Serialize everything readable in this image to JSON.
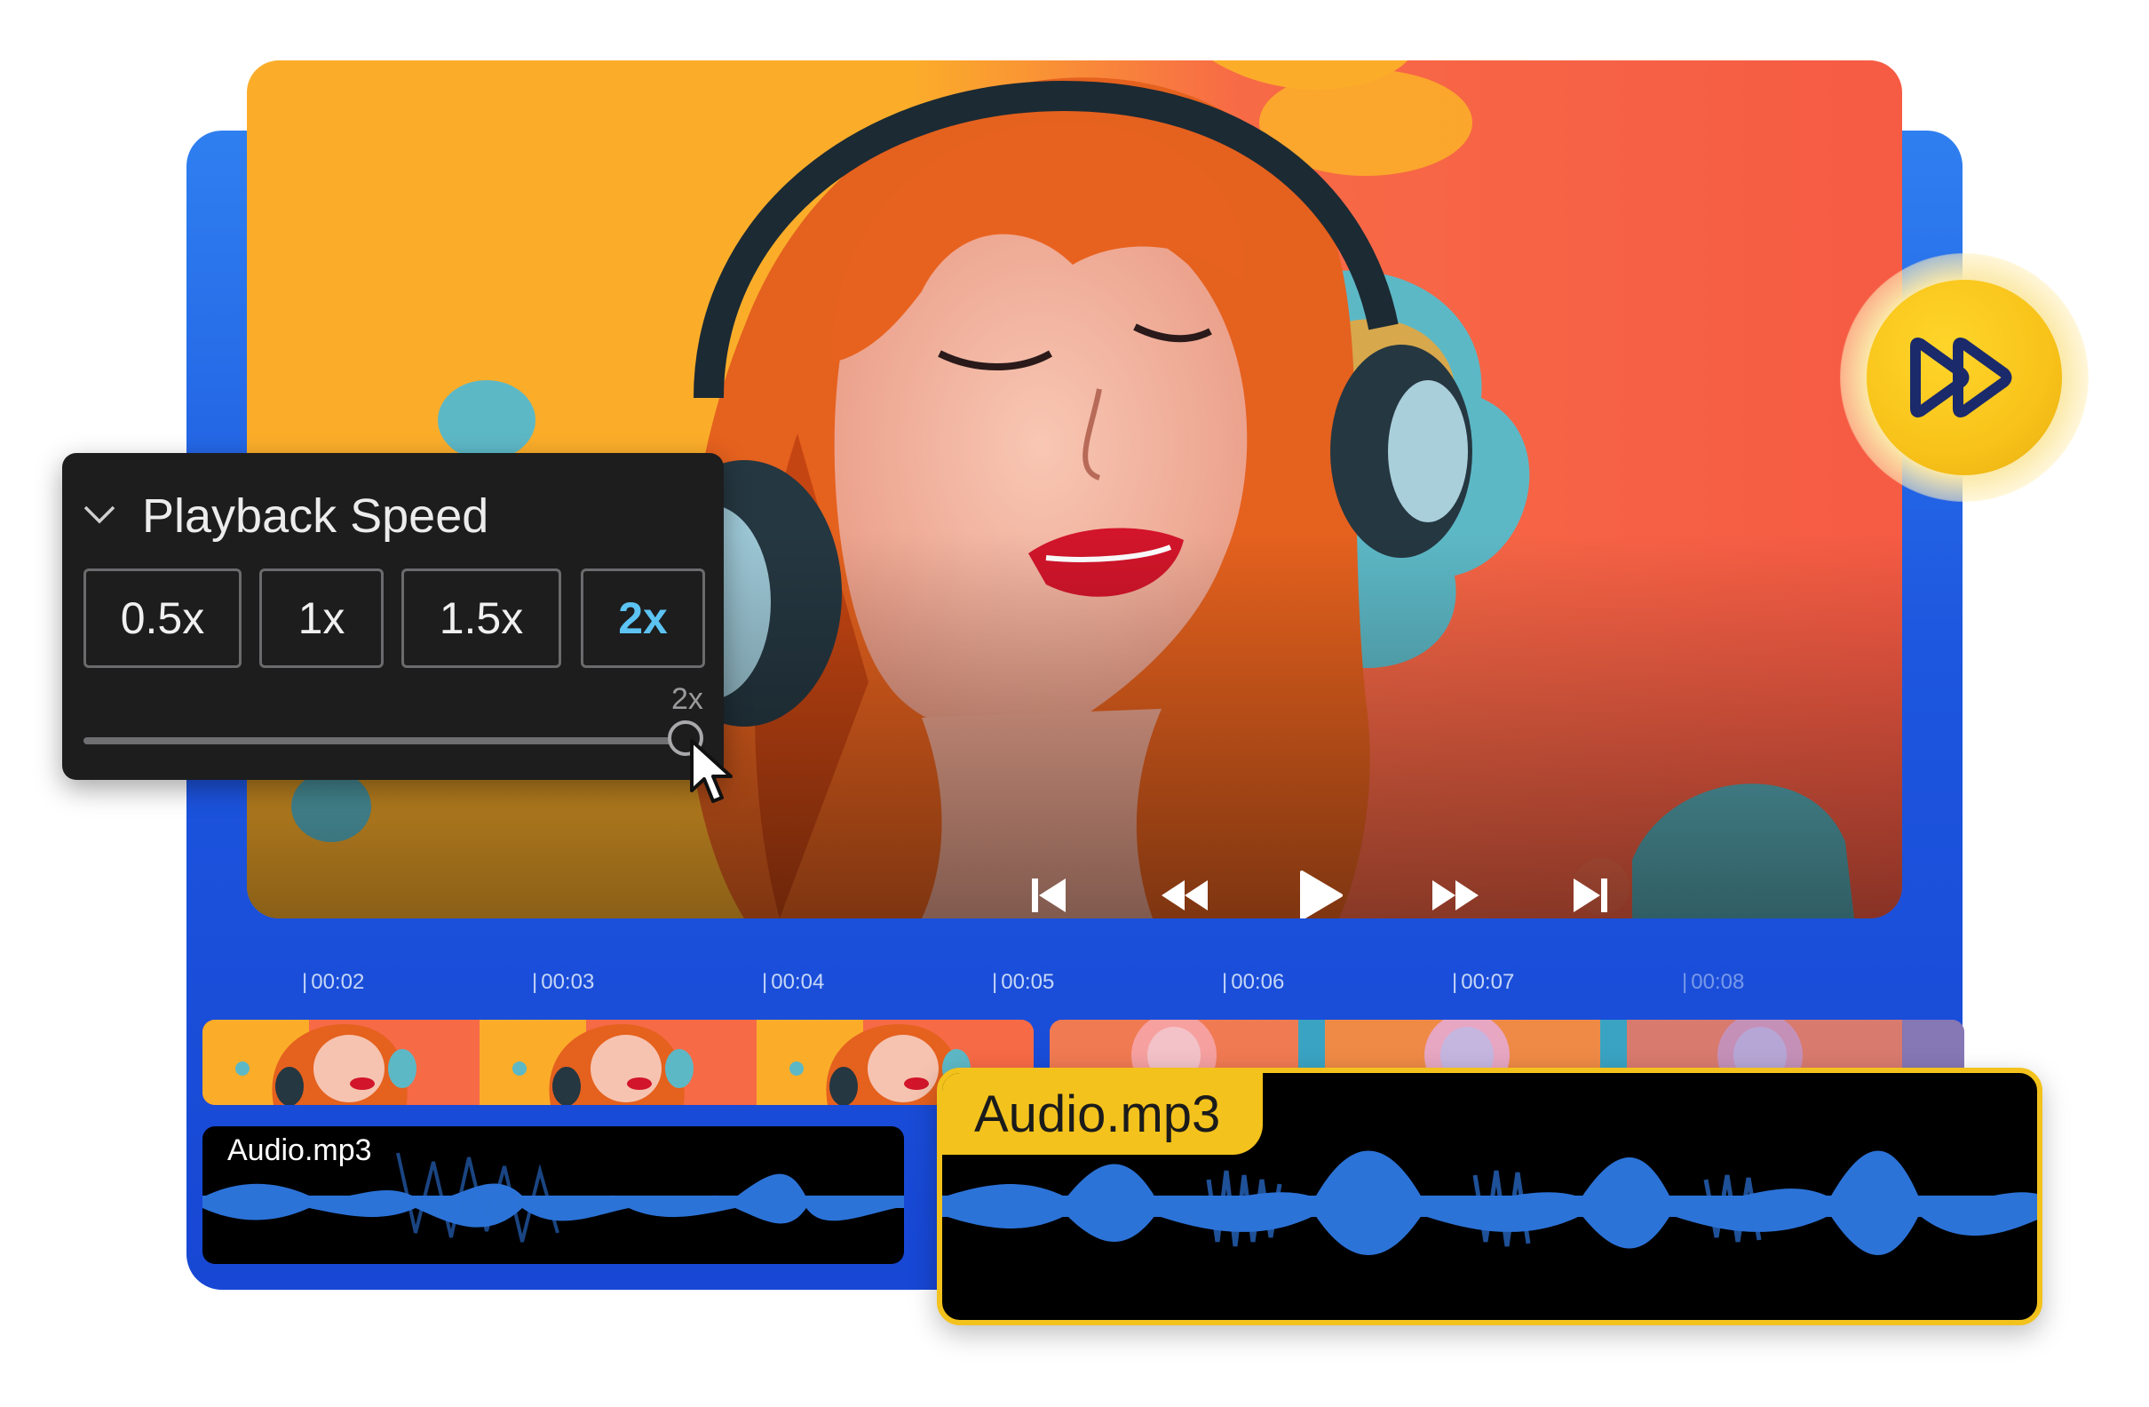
{
  "playback_speed": {
    "title": "Playback Speed",
    "options": [
      "0.5x",
      "1x",
      "1.5x",
      "2x"
    ],
    "selected": "2x",
    "slider_value_label": "2x",
    "accent_color": "#5cc3f2"
  },
  "transport": {
    "icons": [
      "skip-back-icon",
      "rewind-icon",
      "play-icon",
      "fast-forward-icon",
      "skip-forward-icon"
    ]
  },
  "badge": {
    "icon": "fast-forward-icon",
    "color": "#f8c31a"
  },
  "timeline": {
    "ticks": [
      "00:02",
      "00:03",
      "00:04",
      "00:05",
      "00:06",
      "00:07",
      "00:08"
    ]
  },
  "audio_tracks": {
    "small_label": "Audio.mp3",
    "large_label": "Audio.mp3",
    "waveform_color": "#2c73d8",
    "highlight_color": "#f3c21c"
  },
  "colors": {
    "frame_blue": "#1d56df",
    "panel_bg": "#1d1d1e"
  }
}
